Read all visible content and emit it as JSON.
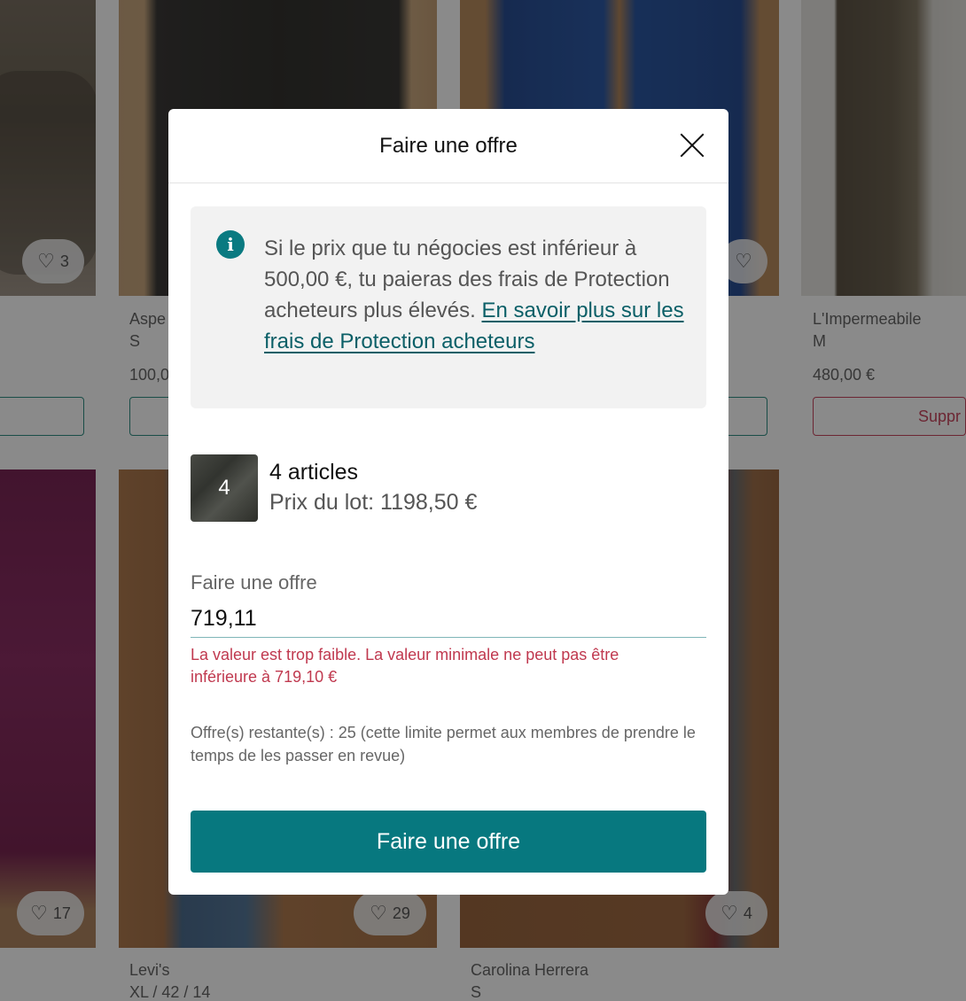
{
  "background": {
    "items": [
      {
        "likes": "3"
      },
      {
        "brand": "Aspe",
        "size": "S",
        "price": "100,0"
      },
      {
        "brand": "L'Impermeabile",
        "size": "M",
        "price": "480,00 €",
        "action_label": "Suppr"
      },
      {
        "likes": "17"
      },
      {
        "brand": "Levi's",
        "size": "XL / 42 / 14",
        "likes": "29"
      },
      {
        "brand": "Carolina Herrera",
        "size": "S",
        "likes": "4"
      }
    ]
  },
  "modal": {
    "title": "Faire une offre",
    "info": {
      "text": "Si le prix que tu négocies est inférieur à 500,00 €, tu paieras des frais de Protection acheteurs plus élevés.",
      "link": "En savoir plus sur les frais de Protection acheteurs"
    },
    "bundle": {
      "count": "4",
      "title": "4 articles",
      "price": "Prix du lot: 1198,50 €"
    },
    "offer": {
      "label": "Faire une offre",
      "value": "719,11",
      "error": "La valeur est trop faible. La valeur minimale ne peut pas être inférieure à 719,10 €"
    },
    "remaining": "Offre(s) restante(s) : 25 (cette limite permet aux membres de prendre le temps de les passer en revue)",
    "submit_label": "Faire une offre"
  },
  "colors": {
    "primary": "#07787f",
    "error": "#c0394f",
    "info_bg": "#f2f2f2"
  },
  "icons": [
    "heart-icon",
    "info-icon",
    "close-icon"
  ]
}
